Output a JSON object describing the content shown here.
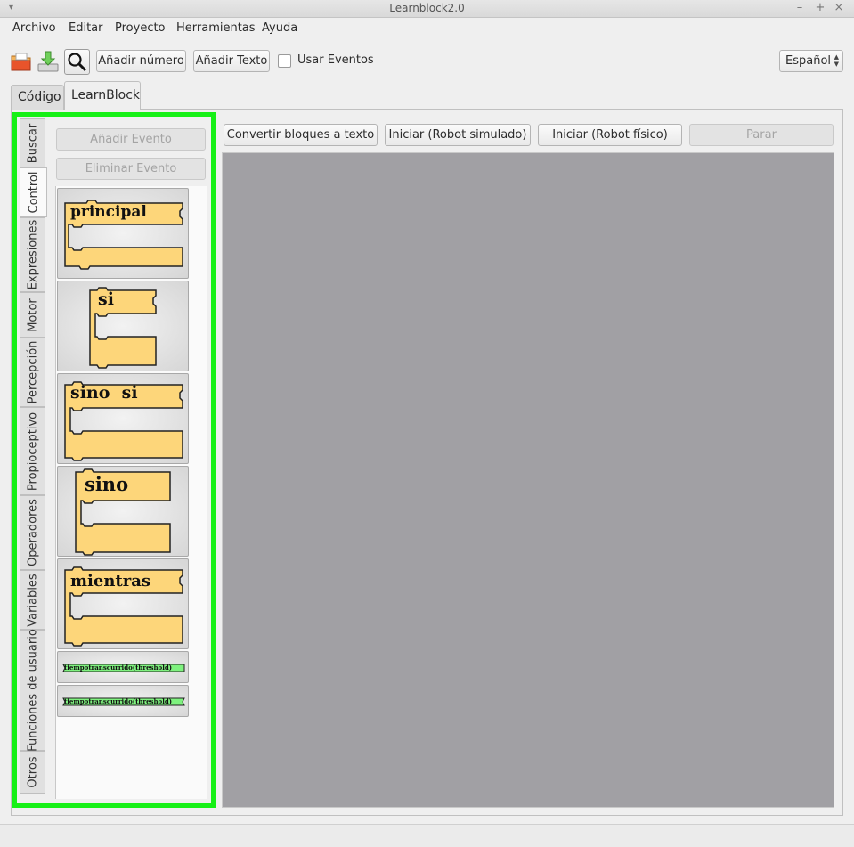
{
  "window": {
    "title": "Learnblock2.0",
    "menu_glyph": "▾",
    "minimize_glyph": "–",
    "maximize_glyph": "+",
    "close_glyph": "×"
  },
  "menubar": {
    "items": [
      "Archivo",
      "Editar",
      "Proyecto",
      "Herramientas",
      "Ayuda"
    ]
  },
  "toolbar": {
    "icons": [
      "open-folder-icon",
      "download-icon",
      "search-icon"
    ],
    "add_number_label": "Añadir número",
    "add_text_label": "Añadir Texto",
    "use_events_label": "Usar Eventos",
    "use_events_checked": false,
    "language_value": "Español",
    "language_arrows": "▲\n▼"
  },
  "tabs": [
    {
      "label": "Código",
      "active": false
    },
    {
      "label": "LearnBlock",
      "active": true
    }
  ],
  "side_tabs": [
    {
      "label": "Buscar",
      "active": false
    },
    {
      "label": "Control",
      "active": true
    },
    {
      "label": "Expresiones",
      "active": false
    },
    {
      "label": "Motor",
      "active": false
    },
    {
      "label": "Percepción",
      "active": false
    },
    {
      "label": "Propioceptivo",
      "active": false
    },
    {
      "label": "Operadores",
      "active": false
    },
    {
      "label": "Variables",
      "active": false
    },
    {
      "label": "Funciones de usuario",
      "active": false
    },
    {
      "label": "Otros",
      "active": false
    }
  ],
  "event_buttons": {
    "add_event_label": "Añadir Evento",
    "remove_event_label": "Eliminar Evento"
  },
  "blocks": [
    {
      "label": "principal"
    },
    {
      "label": "si"
    },
    {
      "label": "sino  si"
    },
    {
      "label": "sino"
    },
    {
      "label": "mientras"
    },
    {
      "label": "tiempotranscurrido(threshold)"
    },
    {
      "label": "tiempotranscurrido(threshold)"
    }
  ],
  "colors": {
    "block_fill": "#fdd67a",
    "green_block_fill": "#7ff27f",
    "highlight_border": "#16f016",
    "canvas_bg": "#a1a0a4"
  },
  "actions": {
    "convert_label": "Convertir bloques a texto",
    "start_sim_label": "Iniciar (Robot simulado)",
    "start_physical_label": "Iniciar (Robot físico)",
    "stop_label": "Parar"
  }
}
